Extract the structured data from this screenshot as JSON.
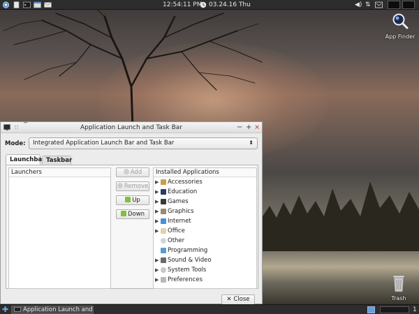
{
  "top_panel": {
    "clock": "12:54:11 PM",
    "date": "03.24.16 Thu",
    "colors": {
      "panel_bg": "#2d2d2d",
      "text": "#e6e6e6"
    }
  },
  "desktop": {
    "app_finder_label": "App Finder",
    "trash_label": "Trash"
  },
  "window": {
    "title": "Application Launch and Task Bar",
    "controls": {
      "minimize": "−",
      "maximize": "+",
      "close": "×"
    },
    "mode_label": "Mode:",
    "mode_value": "Integrated Application Launch Bar and Task Bar",
    "tabs": [
      {
        "label": "Launchbar",
        "active": true
      },
      {
        "label": "Taskbar",
        "active": false
      }
    ],
    "left_list_header": "Launchers",
    "side_buttons": {
      "add": "Add",
      "remove": "Remove",
      "up": "Up",
      "down": "Down"
    },
    "right_list_header": "Installed Applications",
    "categories": [
      {
        "label": "Accessories",
        "icon": "accessories-icon",
        "expandable": true
      },
      {
        "label": "Education",
        "icon": "education-icon",
        "expandable": true
      },
      {
        "label": "Games",
        "icon": "games-icon",
        "expandable": true
      },
      {
        "label": "Graphics",
        "icon": "graphics-icon",
        "expandable": true
      },
      {
        "label": "Internet",
        "icon": "internet-icon",
        "expandable": true
      },
      {
        "label": "Office",
        "icon": "office-icon",
        "expandable": true
      },
      {
        "label": "Other",
        "icon": "other-icon",
        "expandable": false
      },
      {
        "label": "Programming",
        "icon": "programming-icon",
        "expandable": false
      },
      {
        "label": "Sound & Video",
        "icon": "sound-video-icon",
        "expandable": true
      },
      {
        "label": "System Tools",
        "icon": "system-tools-icon",
        "expandable": true
      },
      {
        "label": "Preferences",
        "icon": "preferences-icon",
        "expandable": true
      }
    ],
    "close_label": "Close"
  },
  "bottom_panel": {
    "task_label": "Application Launch and T...",
    "workspace_number": "1"
  }
}
